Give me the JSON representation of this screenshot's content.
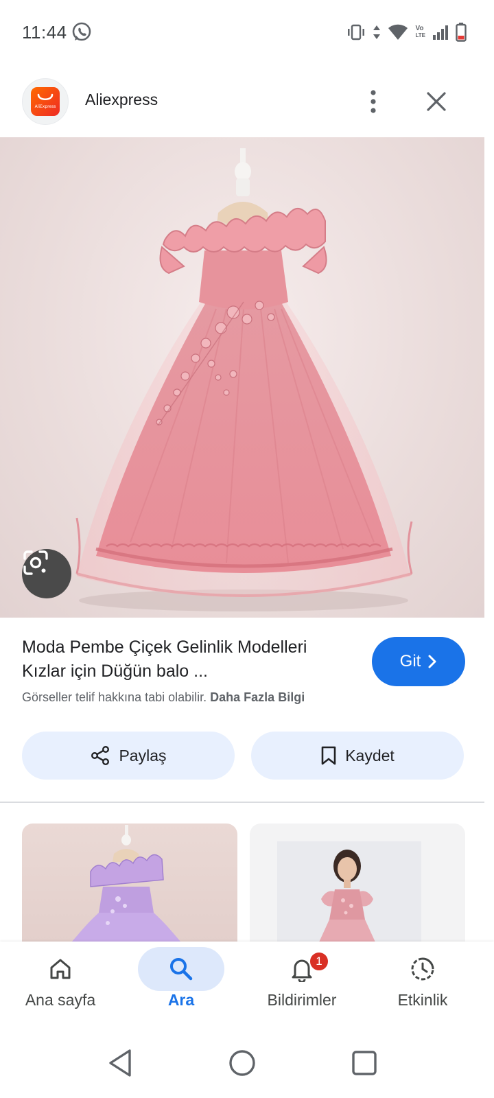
{
  "status_bar": {
    "time": "11:44",
    "icons": [
      "whatsapp-icon",
      "vibrate-icon",
      "data-arrows-icon",
      "wifi-icon",
      "volte-icon",
      "signal-icon",
      "battery-icon"
    ],
    "volte_text_top": "Vo",
    "volte_text_bottom": "LTE"
  },
  "header": {
    "site_name": "Aliexpress",
    "logo_text": "AliExpress"
  },
  "result": {
    "title": "Moda Pembe Çiçek Gelinlik Modelleri Kızlar için Düğün balo ...",
    "go_button": "Git",
    "notice_text": "Görseller telif hakkına tabi olabilir.",
    "notice_link": "Daha Fazla Bilgi",
    "share_label": "Paylaş",
    "save_label": "Kaydet"
  },
  "bottom_nav": {
    "items": [
      {
        "label": "Ana sayfa",
        "icon": "home-icon"
      },
      {
        "label": "Ara",
        "icon": "search-icon"
      },
      {
        "label": "Bildirimler",
        "icon": "bell-icon"
      },
      {
        "label": "Etkinlik",
        "icon": "activity-icon"
      }
    ],
    "notification_count": "1"
  },
  "colors": {
    "accent": "#1a73e8",
    "chip_bg": "#e8f0fe",
    "badge": "#d93025"
  }
}
